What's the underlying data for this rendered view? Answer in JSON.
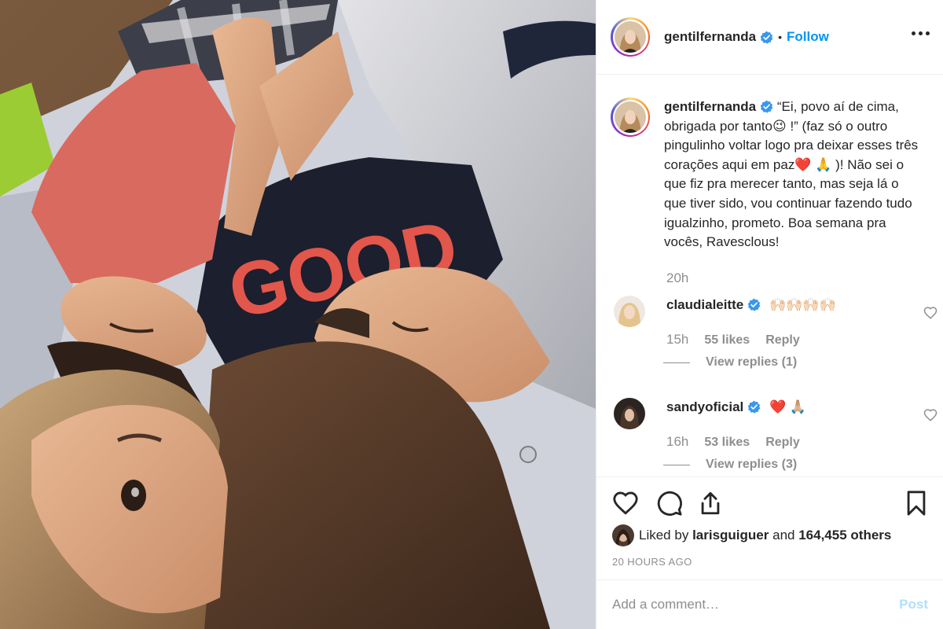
{
  "post": {
    "author": "gentilfernanda",
    "follow_label": "Follow",
    "separator": "•",
    "caption": "“Ei, povo aí de cima, obrigada por tanto😉 !” (faz só o outro pingulinho voltar logo pra deixar esses três corações aqui em paz❤️ 🙏 )! Não sei o que fiz pra merecer tanto, mas seja lá o que tiver sido, vou continuar fazendo tudo igualzinho, prometo. Boa semana pra vocês, Ravesclous!",
    "caption_time": "20h",
    "shirt_text": "GOOD"
  },
  "comments": [
    {
      "user": "claudialeitte",
      "text": "🙌🏻🙌🏻🙌🏻🙌🏻",
      "time": "15h",
      "likes": "55 likes",
      "reply": "Reply",
      "view_replies": "View replies (1)"
    },
    {
      "user": "sandyoficial",
      "text": "❤️ 🙏🏼",
      "time": "16h",
      "likes": "53 likes",
      "reply": "Reply",
      "view_replies": "View replies (3)"
    }
  ],
  "likes": {
    "prefix": "Liked by",
    "user": "larisguiguer",
    "and": "and",
    "count": "164,455 others"
  },
  "timestamp": "20 HOURS AGO",
  "add_comment": {
    "placeholder": "Add a comment…",
    "post_label": "Post"
  },
  "icons": {
    "like": "heart-icon",
    "comment": "comment-icon",
    "share": "share-icon",
    "save": "bookmark-icon",
    "more": "more-dots-icon",
    "verified": "verified-badge-icon"
  },
  "colors": {
    "link_blue": "#0095f6",
    "verified_blue": "#3897f0",
    "muted": "#8e8e8e",
    "text": "#262626",
    "post_disabled": "#b2dffc",
    "divider": "#efefef"
  }
}
